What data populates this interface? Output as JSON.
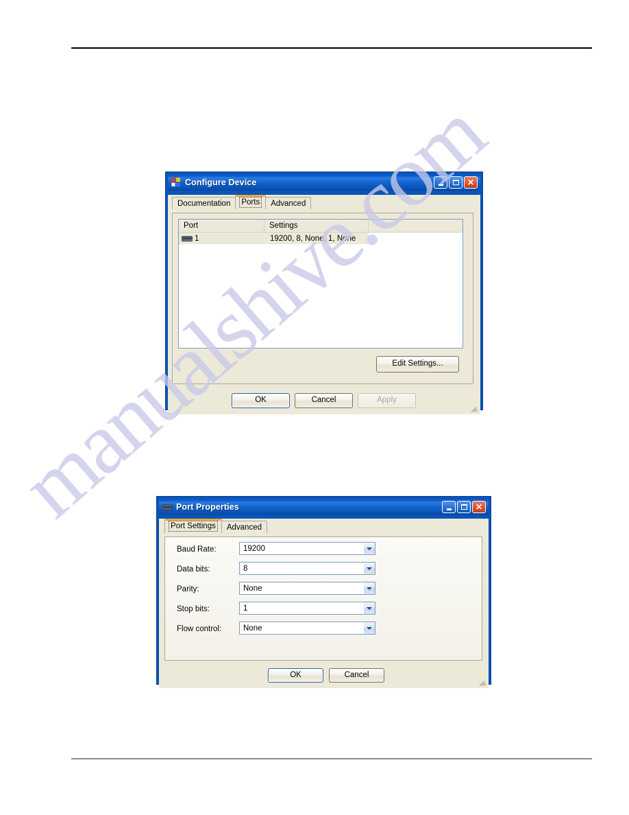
{
  "page": {
    "background": "#ffffff",
    "rule_top_color": "#000000",
    "rule_bottom_color": "#8a8a8a",
    "watermark_text": "manualshive.com",
    "watermark_color": "#c9c9e8"
  },
  "configure_device": {
    "title": "Configure Device",
    "title_icon": "color-blocks-icon",
    "window_buttons": {
      "minimize": "_",
      "maximize": "□",
      "close": "✕"
    },
    "tabs": [
      {
        "label": "Documentation",
        "selected": false
      },
      {
        "label": "Ports",
        "selected": true
      },
      {
        "label": "Advanced",
        "selected": false
      }
    ],
    "list": {
      "columns": [
        "Port",
        "Settings",
        ""
      ],
      "rows": [
        {
          "icon": "serial-port-icon",
          "port": "1",
          "settings": "19200, 8, None, 1, None",
          "selected": true
        }
      ]
    },
    "edit_settings_label": "Edit Settings...",
    "footer_buttons": [
      {
        "label": "OK",
        "state": "default"
      },
      {
        "label": "Cancel",
        "state": "normal"
      },
      {
        "label": "Apply",
        "state": "disabled"
      }
    ]
  },
  "port_properties": {
    "title": "Port Properties",
    "title_icon": "serial-port-icon",
    "window_buttons": {
      "minimize": "_",
      "maximize": "□",
      "close": "✕"
    },
    "tabs": [
      {
        "label": "Port Settings",
        "selected": true
      },
      {
        "label": "Advanced",
        "selected": false
      }
    ],
    "fields": [
      {
        "label": "Baud Rate:",
        "value": "19200"
      },
      {
        "label": "Data bits:",
        "value": "8"
      },
      {
        "label": "Parity:",
        "value": "None"
      },
      {
        "label": "Stop bits:",
        "value": "1"
      },
      {
        "label": "Flow control:",
        "value": "None"
      }
    ],
    "footer_buttons": [
      {
        "label": "OK",
        "state": "default"
      },
      {
        "label": "Cancel",
        "state": "normal"
      }
    ]
  }
}
